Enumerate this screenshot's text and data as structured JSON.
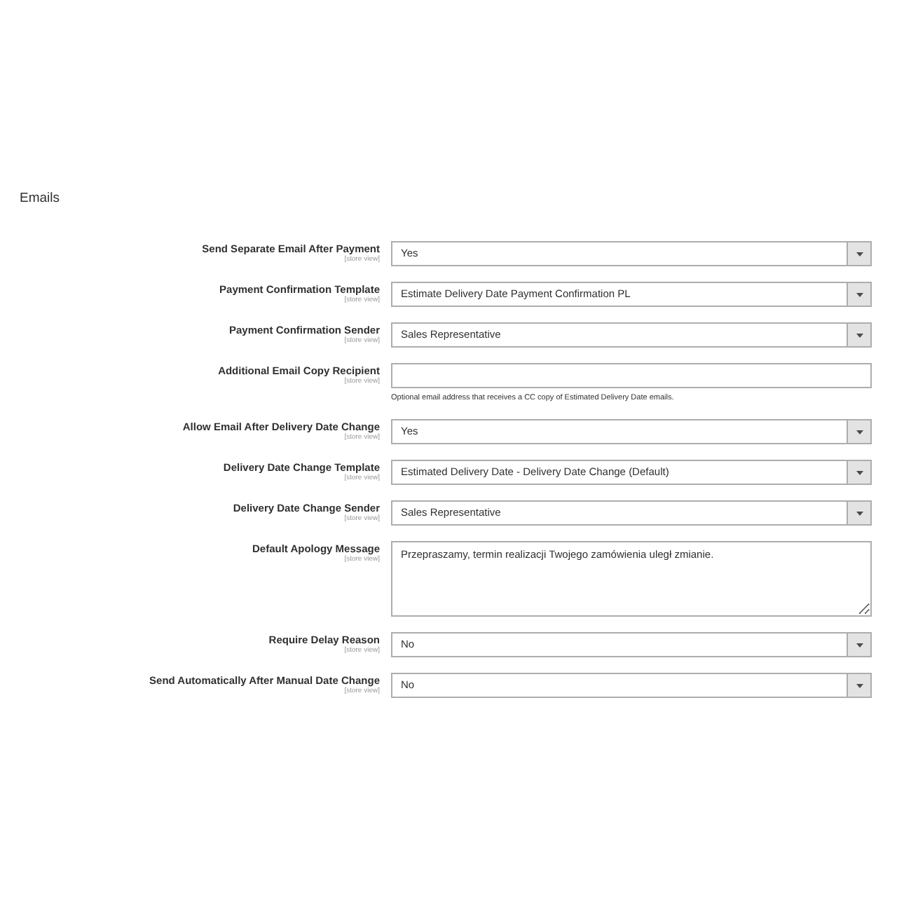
{
  "section": {
    "title": "Emails"
  },
  "fields": [
    {
      "kind": "select",
      "label": "Send Separate Email After Payment",
      "scope": "[store view]",
      "value": "Yes"
    },
    {
      "kind": "select",
      "label": "Payment Confirmation Template",
      "scope": "[store view]",
      "value": "Estimate Delivery Date Payment Confirmation PL"
    },
    {
      "kind": "select",
      "label": "Payment Confirmation Sender",
      "scope": "[store view]",
      "value": "Sales Representative"
    },
    {
      "kind": "text",
      "label": "Additional Email Copy Recipient",
      "scope": "[store view]",
      "comment": "Optional email address that receives a CC copy of Estimated Delivery Date emails."
    },
    {
      "kind": "select",
      "label": "Allow Email After Delivery Date Change",
      "scope": "[store view]",
      "value": "Yes"
    },
    {
      "kind": "select",
      "label": "Delivery Date Change Template",
      "scope": "[store view]",
      "value": "Estimated Delivery Date - Delivery Date Change (Default)"
    },
    {
      "kind": "select",
      "label": "Delivery Date Change Sender",
      "scope": "[store view]",
      "value": "Sales Representative"
    },
    {
      "kind": "textarea",
      "label": "Default Apology Message",
      "scope": "[store view]",
      "value": "Przepraszamy, termin realizacji Twojego zamówienia uległ zmianie."
    },
    {
      "kind": "select",
      "label": "Require Delay Reason",
      "scope": "[store view]",
      "value": "No"
    },
    {
      "kind": "select",
      "label": "Send Automatically After Manual Date Change",
      "scope": "[store view]",
      "value": "No"
    }
  ]
}
